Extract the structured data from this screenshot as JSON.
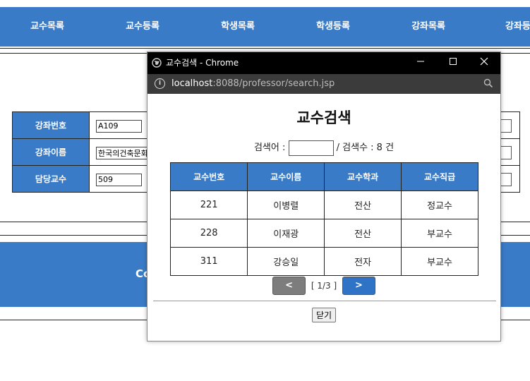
{
  "nav": {
    "items": [
      "교수목록",
      "교수등록",
      "학생목록",
      "학생등록",
      "강좌목록",
      "강좌등록"
    ]
  },
  "form": {
    "rows": [
      {
        "label": "강좌번호",
        "value": "A109"
      },
      {
        "label": "강좌이름",
        "value": "한국의건축문화"
      },
      {
        "label": "담당교수",
        "value": "509"
      }
    ]
  },
  "footer": {
    "text": "Co"
  },
  "popup": {
    "window_title": "교수검색 - Chrome",
    "url_host": "localhost",
    "url_path": ":8088/professor/search.jsp",
    "title": "교수검색",
    "search_label": "검색어 :",
    "search_value": "",
    "count_text": "/ 검색수 : 8 건",
    "columns": [
      "교수번호",
      "교수이름",
      "교수학과",
      "교수직급"
    ],
    "rows": [
      [
        "221",
        "이병렬",
        "전산",
        "정교수"
      ],
      [
        "228",
        "이재광",
        "전산",
        "부교수"
      ],
      [
        "311",
        "강승일",
        "전자",
        "부교수"
      ]
    ],
    "prev_label": "<",
    "next_label": ">",
    "page_info": "[ 1/3 ]",
    "close_label": "닫기"
  }
}
